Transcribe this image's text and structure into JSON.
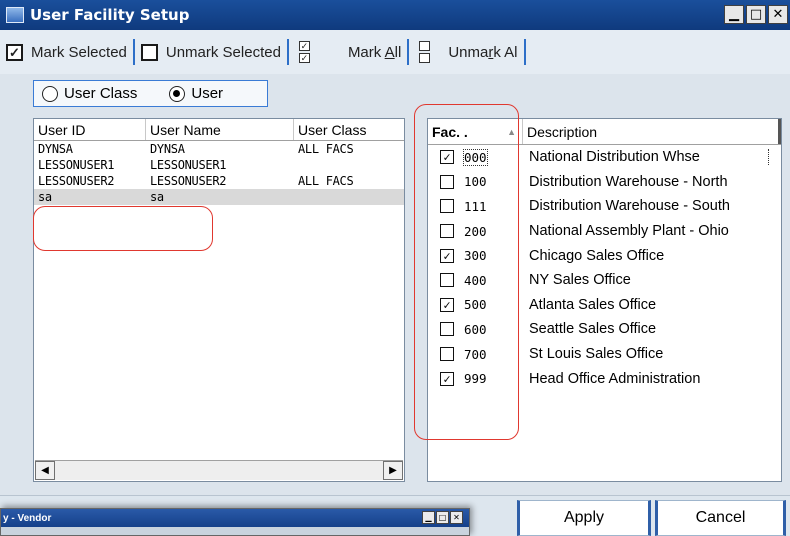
{
  "window": {
    "title": "User Facility Setup",
    "controls": {
      "minimize": "▁",
      "maximize": "□",
      "close": "✕"
    }
  },
  "toolbar": {
    "mark_selected": "Mark Selected",
    "unmark_selected": "Unmark Selected",
    "mark_all_prefix": "Mark ",
    "mark_all_key": "A",
    "mark_all_suffix": "ll",
    "unmark_all_prefix": "Unma",
    "unmark_all_key": "r",
    "unmark_all_suffix": "k Al"
  },
  "filter": {
    "options": [
      {
        "label": "User Class",
        "selected": false
      },
      {
        "label": "User",
        "selected": true
      }
    ]
  },
  "users": {
    "columns": [
      "User ID",
      "User Name",
      "User Class"
    ],
    "rows": [
      {
        "id": "DYNSA",
        "name": "DYNSA",
        "class": "ALL FACS"
      },
      {
        "id": "LESSONUSER1",
        "name": "LESSONUSER1",
        "class": ""
      },
      {
        "id": "LESSONUSER2",
        "name": "LESSONUSER2",
        "class": "ALL FACS"
      },
      {
        "id": "sa",
        "name": "sa",
        "class": ""
      }
    ],
    "selected_index": 3
  },
  "facilities": {
    "columns": [
      "Fac. .",
      "Description"
    ],
    "sort_icon": "▲",
    "rows": [
      {
        "code": "000",
        "desc": "National Distribution Whse",
        "checked": true
      },
      {
        "code": "100",
        "desc": "Distribution Warehouse - North",
        "checked": false
      },
      {
        "code": "111",
        "desc": "Distribution Warehouse - South",
        "checked": false
      },
      {
        "code": "200",
        "desc": "National Assembly Plant - Ohio",
        "checked": false
      },
      {
        "code": "300",
        "desc": "Chicago Sales Office",
        "checked": true
      },
      {
        "code": "400",
        "desc": "NY Sales Office",
        "checked": false
      },
      {
        "code": "500",
        "desc": "Atlanta Sales Office",
        "checked": true
      },
      {
        "code": "600",
        "desc": "Seattle Sales Office",
        "checked": false
      },
      {
        "code": "700",
        "desc": "St Louis Sales Office",
        "checked": false
      },
      {
        "code": "999",
        "desc": "Head Office Administration",
        "checked": true
      }
    ]
  },
  "buttons": {
    "apply": "Apply",
    "cancel": "Cancel"
  },
  "background_window": {
    "title": "y - Vendor"
  },
  "colors": {
    "annotation": "#e0382f",
    "titlebar": "#1a4f9c"
  }
}
